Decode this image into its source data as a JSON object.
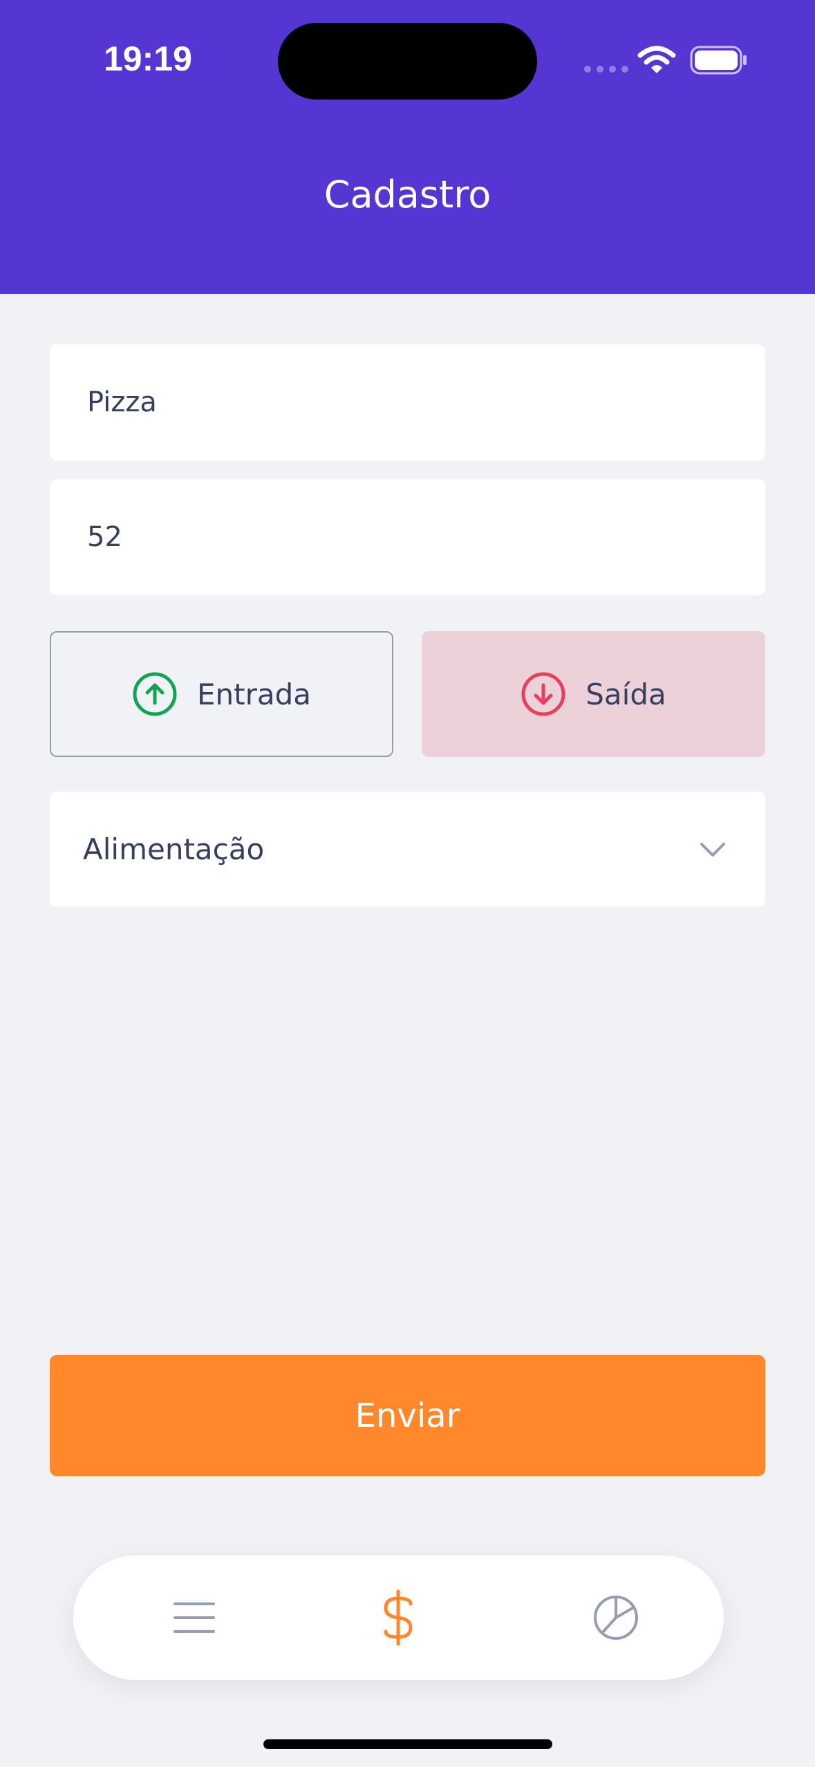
{
  "status_bar": {
    "time": "19:19"
  },
  "header": {
    "title": "Cadastro"
  },
  "form": {
    "name_value": "Pizza",
    "amount_value": "52",
    "type_in_label": "Entrada",
    "type_out_label": "Saída",
    "selected_type": "Saída",
    "category_value": "Alimentação",
    "submit_label": "Enviar"
  },
  "tabbar": {
    "items": [
      "list-icon",
      "dollar-icon",
      "pie-chart-icon"
    ],
    "active": "dollar-icon"
  },
  "colors": {
    "primary": "#5636D3",
    "background": "#F0F2F5",
    "secondary": "#FF872C",
    "success": "#12A454",
    "attention": "#E83F5B",
    "text_dark": "#363F5F",
    "text": "#969CB2",
    "attention_light": "#EDD1D9"
  }
}
